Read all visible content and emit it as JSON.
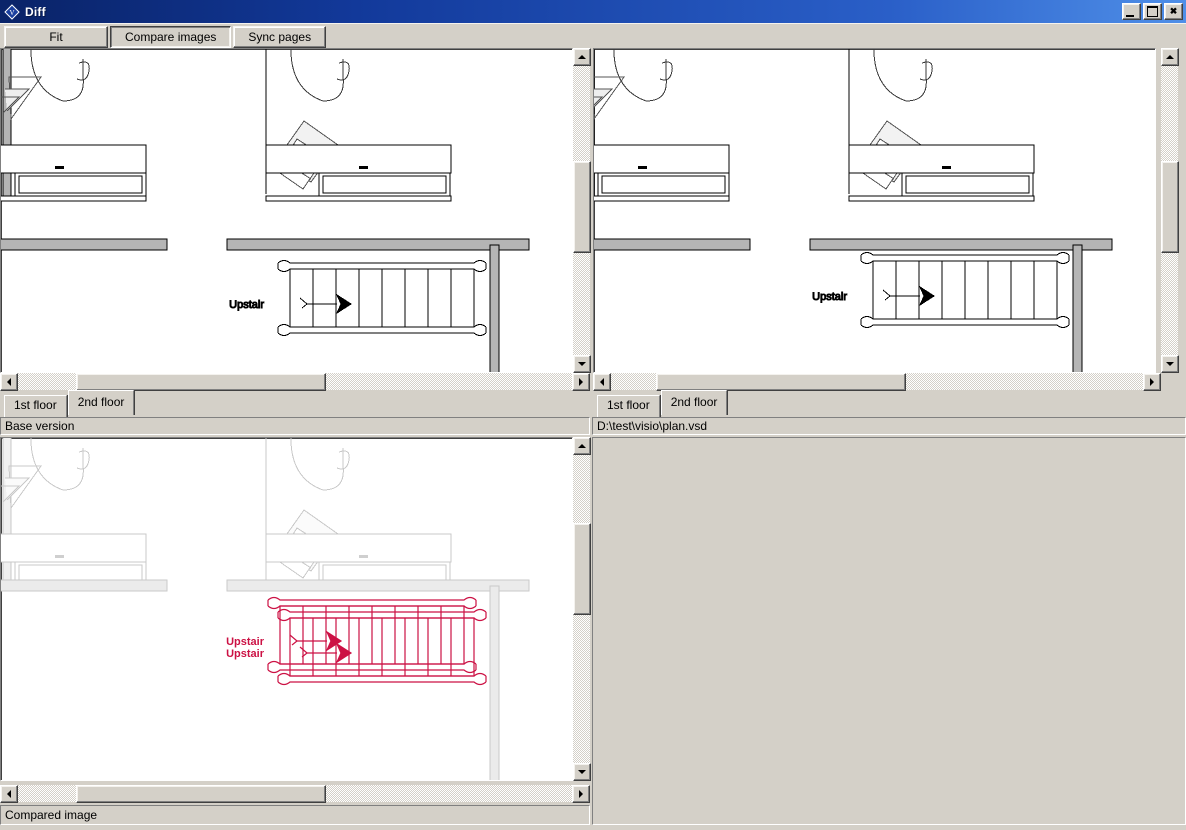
{
  "window": {
    "title": "Diff",
    "icon": "visio-diamond-icon",
    "controls": {
      "minimize": "–",
      "maximize": "□",
      "close": "✕"
    }
  },
  "toolbar": {
    "buttons": [
      {
        "label": "Fit",
        "name": "fit-button",
        "pressed": false
      },
      {
        "label": "Compare images",
        "name": "compare-images-button",
        "pressed": true
      },
      {
        "label": "Sync pages",
        "name": "sync-pages-button",
        "pressed": false
      }
    ]
  },
  "panes": {
    "top_left": {
      "name": "base-version-pane",
      "tabs": [
        {
          "label": "1st floor",
          "active": false
        },
        {
          "label": "2nd floor",
          "active": true
        }
      ],
      "info": "Base version",
      "scroll": {
        "v_thumb_pct": 30,
        "h_thumb_pct": 14
      }
    },
    "top_right": {
      "name": "modified-version-pane",
      "tabs": [
        {
          "label": "1st floor",
          "active": false
        },
        {
          "label": "2nd floor",
          "active": true
        }
      ],
      "info": "D:\\test\\visio\\plan.vsd",
      "scroll": {
        "v_thumb_pct": 30,
        "h_thumb_pct": 52
      }
    },
    "bottom_left": {
      "name": "compared-image-pane",
      "info": "Compared image",
      "scroll": {
        "v_thumb_pct": 30,
        "h_thumb_pct": 14
      }
    },
    "bottom_right": {
      "name": "empty-pane",
      "info": ""
    }
  },
  "drawing": {
    "label_upstair": "Upstair",
    "colors": {
      "wall_fill": "#b5b5b5",
      "wall_stroke": "#000000",
      "furniture_stroke": "#000000",
      "diff_highlight": "#cc1144",
      "faded_stroke": "#c8c8c8",
      "canvas": "#ffffff",
      "chrome": "#d4d0c8",
      "titlebar": "#0a246a"
    }
  }
}
